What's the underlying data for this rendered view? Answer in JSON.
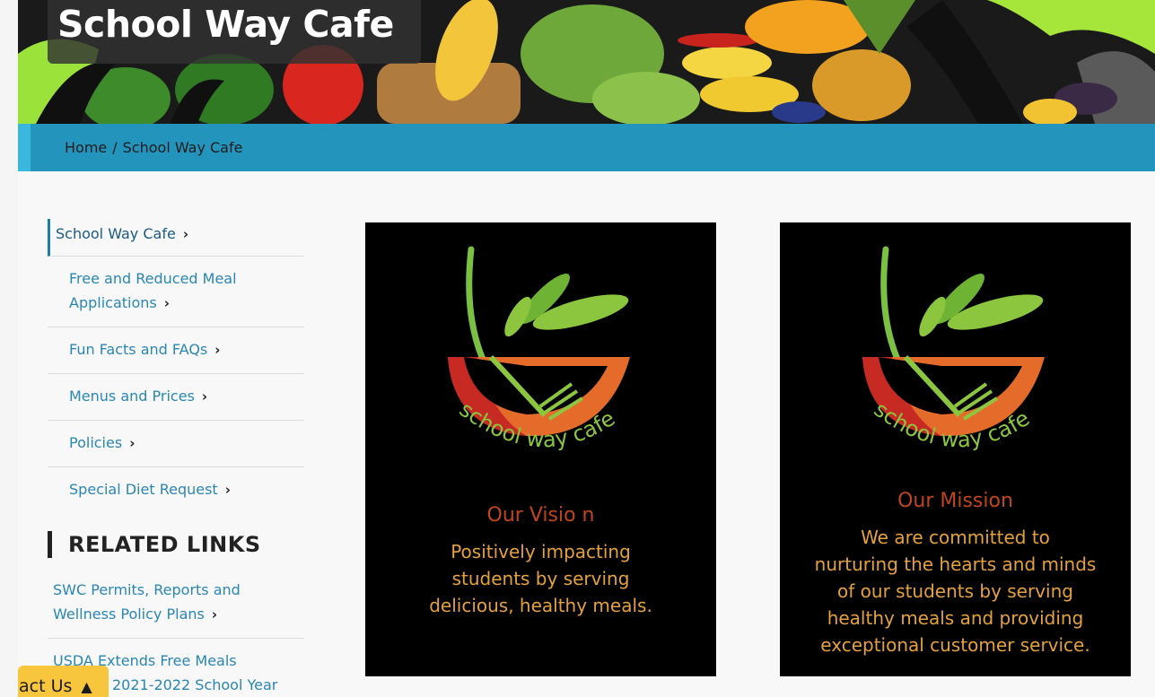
{
  "banner": {
    "title": "School Way Cafe"
  },
  "breadcrumb": {
    "home": "Home",
    "separator": "/",
    "current": "School Way Cafe"
  },
  "sidenav": {
    "current": "School Way Cafe",
    "items": [
      {
        "label_line1": "Free and Reduced Meal",
        "label_line2": "Applications"
      },
      {
        "label_line1": "Fun Facts and FAQs"
      },
      {
        "label_line1": "Menus and Prices"
      },
      {
        "label_line1": "Policies"
      },
      {
        "label_line1": "Special Diet Request"
      }
    ]
  },
  "related": {
    "heading": "RELATED LINKS",
    "items": [
      {
        "line1": "SWC Permits, Reports and",
        "line2": "Wellness Policy Plans"
      },
      {
        "line1": "USDA Extends Free Meals",
        "line2": "2021-2022 School Year"
      }
    ]
  },
  "cards": [
    {
      "logo_text": "school way cafe",
      "heading": "Our Visio n",
      "lines": [
        "Positively impacting",
        "students by serving",
        "delicious, healthy meals."
      ]
    },
    {
      "logo_text": "school way cafe",
      "heading": "Our Mission",
      "lines": [
        "We are committed to",
        "nurturing the hearts and minds",
        "of our students by serving",
        "healthy meals and providing",
        "exceptional customer service."
      ]
    }
  ],
  "contact": {
    "label": "act Us",
    "arrow": "▲"
  },
  "colors": {
    "breadcrumb_bar": "#2395bd",
    "link": "#2a86b3",
    "contact_tab": "#f8c63c",
    "card_heading": "#c0451c",
    "card_body": "#e5a13a"
  }
}
